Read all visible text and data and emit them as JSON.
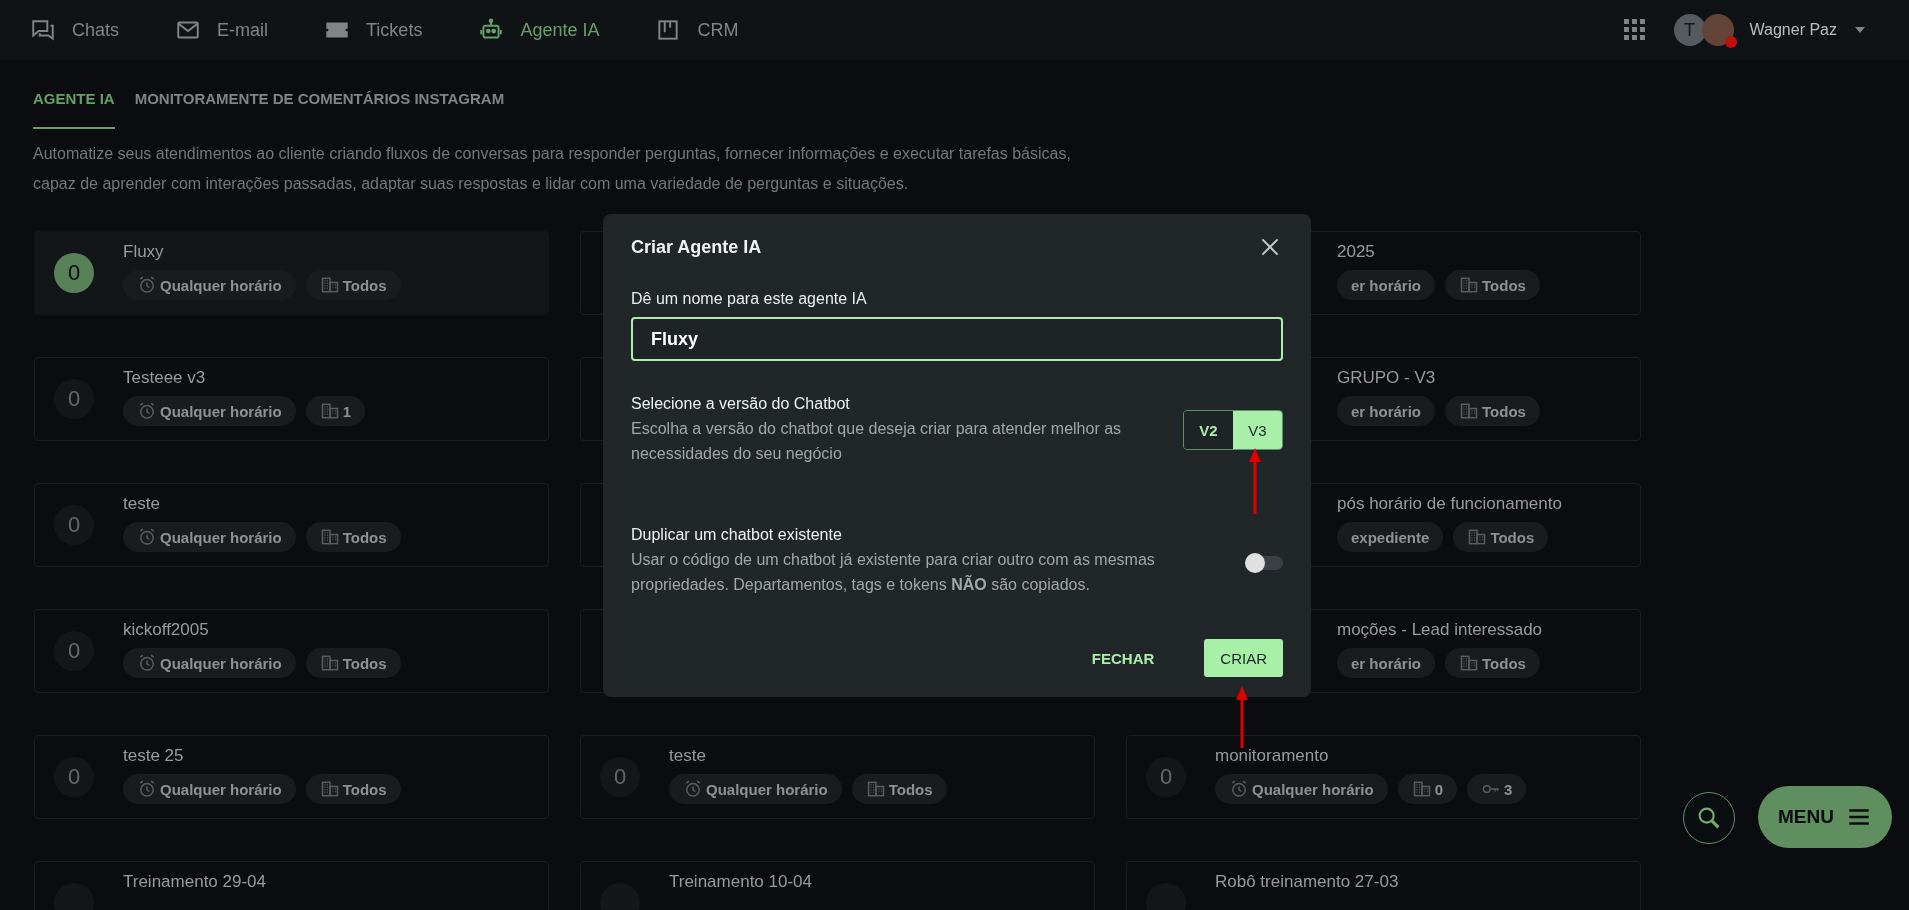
{
  "nav": {
    "items": [
      {
        "label": "Chats",
        "selected": false
      },
      {
        "label": "E-mail",
        "selected": false
      },
      {
        "label": "Tickets",
        "selected": false
      },
      {
        "label": "Agente IA",
        "selected": true
      },
      {
        "label": "CRM",
        "selected": false
      }
    ],
    "user": {
      "initial": "T",
      "name": "Wagner Paz"
    }
  },
  "tabs": [
    {
      "label": "AGENTE IA",
      "selected": true
    },
    {
      "label": "MONITORAMENTE DE COMENTÁRIOS INSTAGRAM",
      "selected": false
    }
  ],
  "description_lines": [
    "Automatize seus atendimentos ao cliente criando fluxos de conversas para responder perguntas, fornecer informações e executar tarefas básicas,",
    "capaz de aprender com interações passadas, adaptar suas respostas e lidar com uma variedade de perguntas e situações."
  ],
  "cards": [
    {
      "kind": "full",
      "selected": true,
      "count": "0",
      "title": "Fluxy",
      "chips": [
        {
          "kind": "schedule",
          "text": "Qualquer horário"
        },
        {
          "kind": "department",
          "text": "Todos"
        }
      ]
    },
    {
      "kind": "covered"
    },
    {
      "kind": "partial",
      "title": "2025",
      "chips": [
        {
          "kind": "plain",
          "text": "er horário"
        },
        {
          "kind": "department",
          "text": "Todos"
        }
      ]
    },
    {
      "kind": "full",
      "selected": false,
      "count": "0",
      "title": "Testeee v3",
      "chips": [
        {
          "kind": "schedule",
          "text": "Qualquer horário"
        },
        {
          "kind": "department",
          "text": "1"
        }
      ]
    },
    {
      "kind": "covered"
    },
    {
      "kind": "partial",
      "title": "GRUPO - V3",
      "chips": [
        {
          "kind": "plain",
          "text": "er horário"
        },
        {
          "kind": "department",
          "text": "Todos"
        }
      ]
    },
    {
      "kind": "full",
      "selected": false,
      "count": "0",
      "title": "teste",
      "chips": [
        {
          "kind": "schedule",
          "text": "Qualquer horário"
        },
        {
          "kind": "department",
          "text": "Todos"
        }
      ]
    },
    {
      "kind": "covered"
    },
    {
      "kind": "partial",
      "title": "pós horário de funcionamento",
      "chips": [
        {
          "kind": "plain",
          "text": "expediente"
        },
        {
          "kind": "department",
          "text": "Todos"
        }
      ]
    },
    {
      "kind": "full",
      "selected": false,
      "count": "0",
      "title": "kickoff2005",
      "chips": [
        {
          "kind": "schedule",
          "text": "Qualquer horário"
        },
        {
          "kind": "department",
          "text": "Todos"
        }
      ]
    },
    {
      "kind": "covered"
    },
    {
      "kind": "partial",
      "title": "moções - Lead interessado",
      "chips": [
        {
          "kind": "plain",
          "text": "er horário"
        },
        {
          "kind": "department",
          "text": "Todos"
        }
      ]
    },
    {
      "kind": "full",
      "selected": false,
      "count": "0",
      "title": "teste 25",
      "chips": [
        {
          "kind": "schedule",
          "text": "Qualquer horário"
        },
        {
          "kind": "department",
          "text": "Todos"
        }
      ]
    },
    {
      "kind": "full",
      "selected": false,
      "count": "0",
      "title": "teste",
      "chips": [
        {
          "kind": "schedule",
          "text": "Qualquer horário"
        },
        {
          "kind": "department",
          "text": "Todos"
        }
      ]
    },
    {
      "kind": "full",
      "selected": false,
      "count": "0",
      "title": "monitoramento",
      "chips": [
        {
          "kind": "schedule",
          "text": "Qualquer horário"
        },
        {
          "kind": "department",
          "text": "0"
        },
        {
          "kind": "token",
          "text": "3"
        }
      ]
    },
    {
      "kind": "full",
      "selected": false,
      "title": "Treinamento 29-04"
    },
    {
      "kind": "full",
      "selected": false,
      "title": "Treinamento 10-04"
    },
    {
      "kind": "full",
      "selected": false,
      "title": "Robô treinamento 27-03"
    }
  ],
  "dialog": {
    "title": "Criar Agente IA",
    "name_label": "Dê um nome para este agente IA",
    "name_value": "Fluxy",
    "version_title": "Selecione a versão do Chatbot",
    "version_text": "Escolha a versão do chatbot que deseja criar para atender melhor as necessidades do seu negócio",
    "versions": [
      {
        "label": "V2",
        "selected": false
      },
      {
        "label": "V3",
        "selected": true
      }
    ],
    "duplicate_title": "Duplicar um chatbot existente",
    "duplicate_text": "Usar o código de um chatbot já existente para criar outro com as mesmas propriedades. Departamentos, tags e tokens **NÃO** são copiados.",
    "duplicate_on": false,
    "buttons": [
      {
        "label": "FECHAR",
        "kind": "text"
      },
      {
        "label": "CRIAR",
        "kind": "primary"
      }
    ]
  },
  "fab": {
    "menu_label": "MENU"
  }
}
